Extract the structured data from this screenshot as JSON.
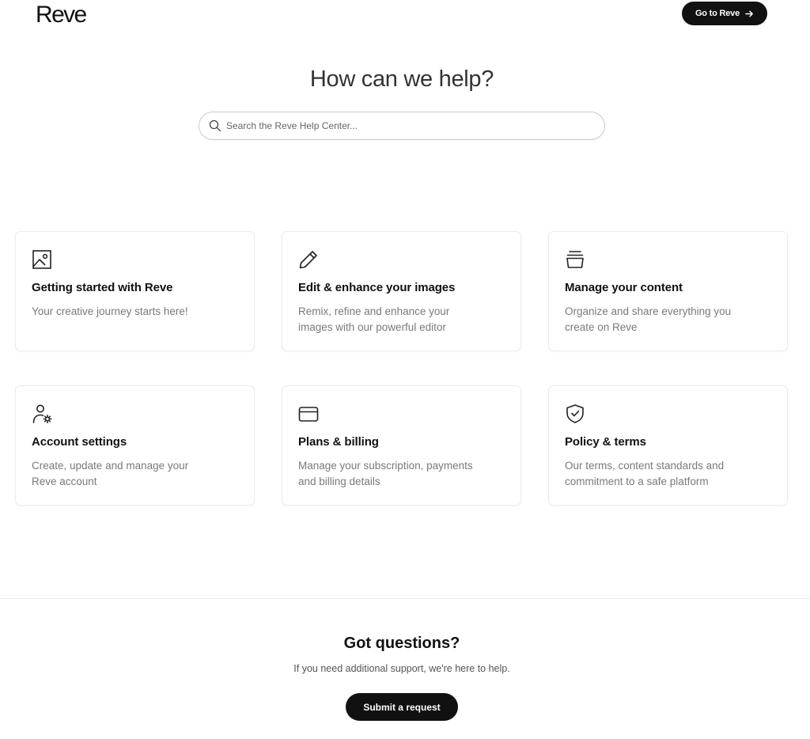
{
  "header": {
    "logo": "Reve",
    "cta_label": "Go to Reve"
  },
  "hero": {
    "title": "How can we help?",
    "search_placeholder": "Search the Reve Help Center..."
  },
  "cards": [
    {
      "icon": "image-icon",
      "title": "Getting started with Reve",
      "description": "Your creative journey starts here!"
    },
    {
      "icon": "pencil-icon",
      "title": "Edit & enhance your images",
      "description": "Remix, refine and enhance your images with our powerful editor"
    },
    {
      "icon": "stack-icon",
      "title": "Manage your content",
      "description": "Organize and share everything you create on Reve"
    },
    {
      "icon": "user-gear-icon",
      "title": "Account settings",
      "description": "Create, update and manage your Reve account"
    },
    {
      "icon": "credit-card-icon",
      "title": "Plans & billing",
      "description": "Manage your subscription, payments and billing details"
    },
    {
      "icon": "shield-check-icon",
      "title": "Policy & terms",
      "description": "Our terms, content standards and commitment to a safe platform"
    }
  ],
  "footer": {
    "title": "Got questions?",
    "subtitle": "If you need additional support, we're here to help.",
    "button_label": "Submit a request"
  },
  "colors": {
    "primary": "#111111",
    "muted_text": "#7a7a7a",
    "border": "#ececec"
  }
}
